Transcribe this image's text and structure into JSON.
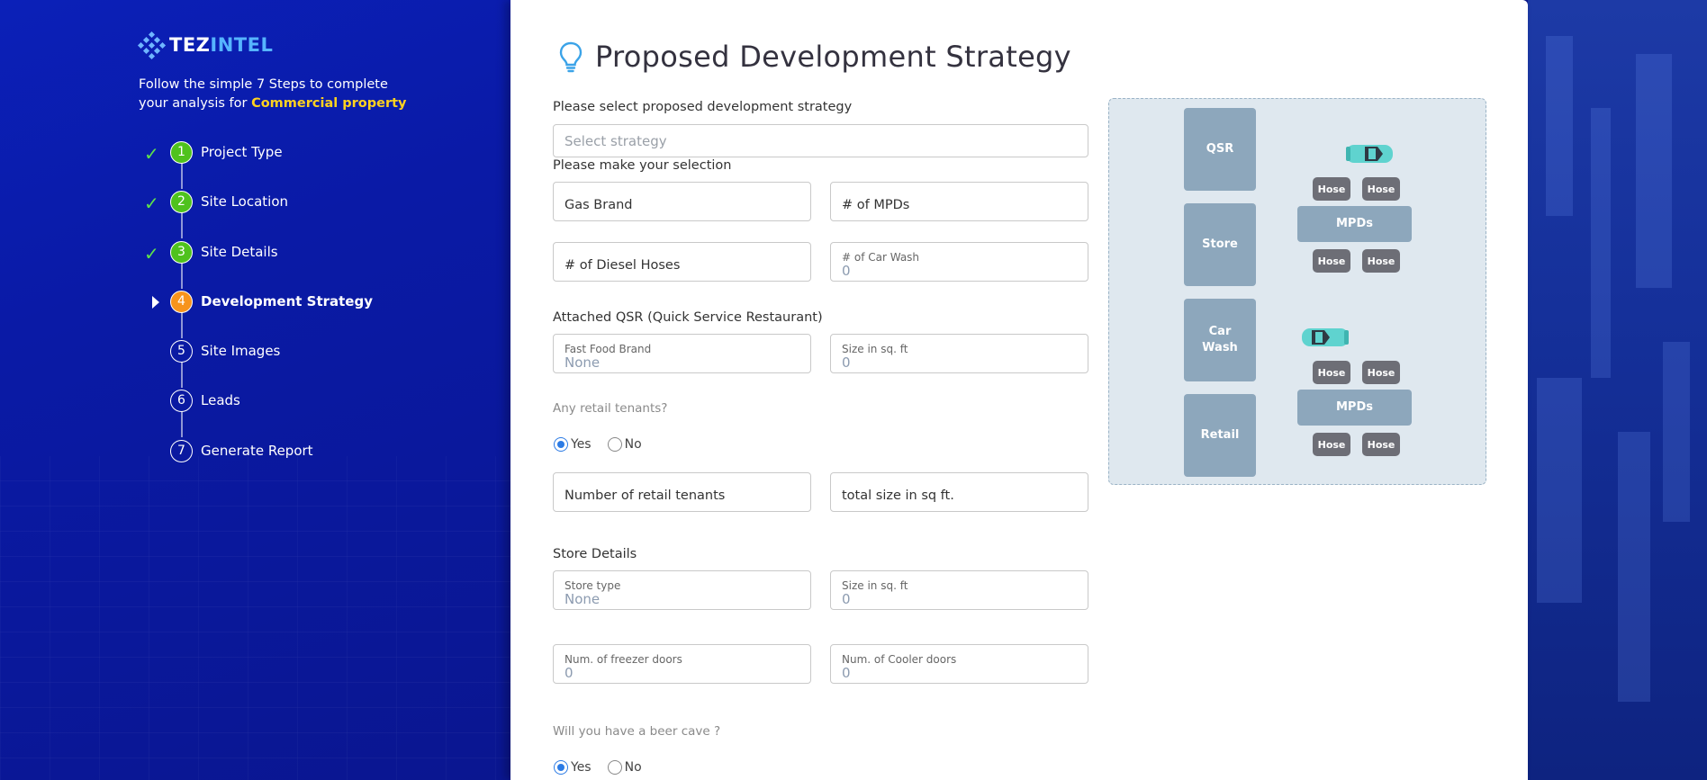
{
  "brand": {
    "name_part1": "TEZ",
    "name_part2": "INTEL"
  },
  "intro": {
    "line1": "Follow the simple 7 Steps to complete",
    "line2_prefix": "your analysis for ",
    "highlight": "Commercial property"
  },
  "steps": [
    {
      "num": "1",
      "label": "Project Type",
      "status": "done"
    },
    {
      "num": "2",
      "label": "Site Location",
      "status": "done"
    },
    {
      "num": "3",
      "label": "Site Details",
      "status": "done"
    },
    {
      "num": "4",
      "label": "Development Strategy",
      "status": "active"
    },
    {
      "num": "5",
      "label": "Site Images",
      "status": "pending"
    },
    {
      "num": "6",
      "label": "Leads",
      "status": "pending"
    },
    {
      "num": "7",
      "label": "Generate Report",
      "status": "pending"
    }
  ],
  "page": {
    "title": "Proposed Development Strategy",
    "icon": "lightbulb-icon"
  },
  "form": {
    "strategy_question": "Please select proposed development strategy",
    "strategy_placeholder": "Select strategy",
    "selection_label": "Please make your selection",
    "gas_brand": "Gas Brand",
    "num_mpds": "# of MPDs",
    "diesel_hoses": "# of Diesel Hoses",
    "car_wash_label": "# of Car Wash",
    "car_wash_value": "0",
    "qsr_label": "Attached QSR (Quick Service Restaurant)",
    "fast_food_label": "Fast Food Brand",
    "fast_food_value": "None",
    "qsr_size_label": "Size in sq. ft",
    "qsr_size_value": "0",
    "retail_question": "Any retail tenants?",
    "yes": "Yes",
    "no": "No",
    "retail_tenants": "Number of retail tenants",
    "retail_total_size": "total size in sq ft.",
    "store_details_label": "Store Details",
    "store_type_label": "Store type",
    "store_type_value": "None",
    "store_size_label": "Size in sq. ft",
    "store_size_value": "0",
    "freezer_label": "Num. of freezer doors",
    "freezer_value": "0",
    "cooler_label": "Num. of Cooler doors",
    "cooler_value": "0",
    "beer_cave_question": "Will you have a beer cave ?",
    "retail_selected": "Yes",
    "beer_cave_selected": "Yes"
  },
  "diagram": {
    "qsr": "QSR",
    "store": "Store",
    "car_wash_line1": "Car",
    "car_wash_line2": "Wash",
    "retail": "Retail",
    "mpds": "MPDs",
    "hose": "Hose"
  },
  "colors": {
    "sidebar": "#0b20b8",
    "highlight": "#ffd21f",
    "step_done": "#4fc21d",
    "step_active": "#f7941d",
    "radio": "#2c7be5"
  }
}
